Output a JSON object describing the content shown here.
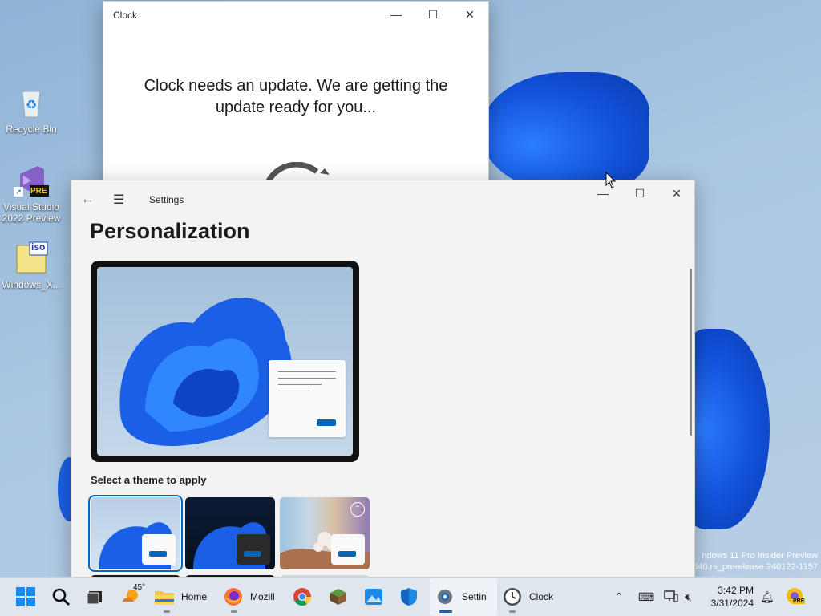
{
  "desktop": {
    "icons": [
      {
        "label": "Recycle Bin"
      },
      {
        "label": "Visual Studio 2022 Preview",
        "badge": "PRE"
      },
      {
        "label": "Windows_X...",
        "badge": "iso"
      }
    ],
    "watermark": {
      "line1": "ndows 11 Pro Insider Preview",
      "line2": "640.rs_prerelease.240122-1157"
    }
  },
  "clock_window": {
    "title": "Clock",
    "message": "Clock needs an update. We are getting the update ready for you..."
  },
  "settings_window": {
    "title": "Settings",
    "heading": "Personalization",
    "select_theme_label": "Select a theme to apply",
    "themes": [
      {
        "name": "light-bloom",
        "selected": true
      },
      {
        "name": "dark-bloom",
        "selected": false
      },
      {
        "name": "flower",
        "selected": false
      }
    ]
  },
  "taskbar": {
    "weather_temp": "45°",
    "items": [
      {
        "label": "Home",
        "icon": "file-explorer-icon"
      },
      {
        "label": "Mozill",
        "icon": "firefox-icon"
      },
      {
        "label": "Settin",
        "icon": "settings-gear-icon"
      },
      {
        "label": "Clock",
        "icon": "clock-icon"
      }
    ],
    "tray_badge": "PRE",
    "time": "3:42 PM",
    "date": "3/31/2024"
  },
  "colors": {
    "accent": "#0067c0",
    "bloom": "#1a5fe6",
    "taskbar": "#dfe6ee"
  }
}
